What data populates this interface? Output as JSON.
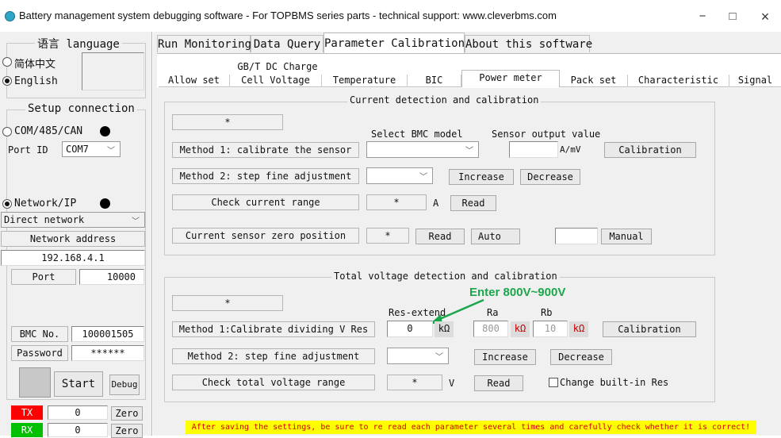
{
  "window": {
    "title": "Battery management system debugging software - For TOPBMS series parts - technical support: www.cleverbms.com",
    "minimize": "−",
    "maximize": "□",
    "close": "×"
  },
  "left": {
    "language_title": "语言 language",
    "lang_cn": "简体中文",
    "lang_en": "English",
    "setup_title": "Setup connection",
    "com_label": "COM/485/CAN",
    "port_id_label": "Port ID",
    "port_id_value": "COM7",
    "network_label": "Network/IP",
    "network_mode": "Direct network",
    "network_address_label": "Network address",
    "ip_value": "192.168.4.1",
    "port_label": "Port",
    "port_value": "10000",
    "bmc_label": "BMC No.",
    "bmc_value": "100001505",
    "password_label": "Password",
    "password_value": "******",
    "start_label": "Start",
    "debug_label": "Debug",
    "tx_label": "TX",
    "tx_value": "0",
    "rx_label": "RX",
    "rx_value": "0",
    "zero_label": "Zero",
    "tx_color": "#ff0000",
    "rx_color": "#00c000"
  },
  "tabs": [
    "Run Monitoring",
    "Data Query",
    "Parameter Calibration",
    "About this software"
  ],
  "subtabs_top": [
    "GB/T DC Charge"
  ],
  "subtabs": [
    "Allow set",
    "Cell Voltage",
    "Temperature",
    "BIC",
    "Power meter",
    "Pack set",
    "Characteristic",
    "Signal"
  ],
  "current": {
    "group_title": "Current detection and calibration",
    "status": "*",
    "select_model_label": "Select BMC model",
    "sensor_output_label": "Sensor output value",
    "method1_label": "Method 1: calibrate the sensor",
    "unit_amv": "A/mV",
    "calibration_btn": "Calibration",
    "method2_label": "Method 2: step fine adjustment",
    "increase_btn": "Increase",
    "decrease_btn": "Decrease",
    "check_range_label": "Check current range",
    "range_value": "*",
    "unit_a": "A",
    "read_btn": "Read",
    "zero_pos_label": "Current sensor zero position",
    "zero_value": "*",
    "read_btn2": "Read",
    "auto_btn": "Auto",
    "manual_btn": "Manual"
  },
  "voltage": {
    "group_title": "Total voltage detection and calibration",
    "status": "*",
    "annotation": "Enter 800V~900V",
    "res_extend_label": "Res-extend",
    "ra_label": "Ra",
    "rb_label": "Rb",
    "method1_label": "Method 1:Calibrate dividing V Res",
    "res_extend_value": "0",
    "ra_value": "800",
    "rb_value": "10",
    "unit_kohm": "kΩ",
    "calibration_btn": "Calibration",
    "method2_label": "Method 2: step fine adjustment",
    "increase_btn": "Increase",
    "decrease_btn": "Decrease",
    "check_range_label": "Check total voltage range",
    "range_value": "*",
    "unit_v": "V",
    "read_btn": "Read",
    "builtin_label": "Change built-in Res"
  },
  "footer": {
    "warning": "After saving the settings, be sure to re read each parameter several times and carefully check whether it is correct!"
  },
  "colors": {
    "annotation_arrow": "#1aa64a",
    "warning_bg": "#ffff00",
    "warning_text": "#d40000",
    "kohm_text": "#c00000"
  }
}
